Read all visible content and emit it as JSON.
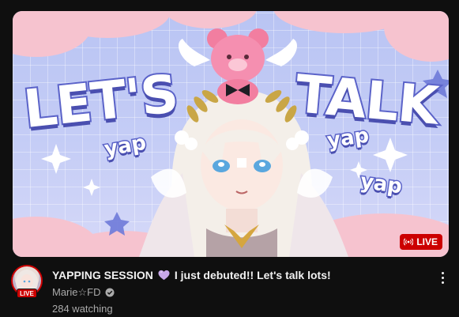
{
  "video": {
    "thumbnail_words": {
      "headline_left": "LET'S",
      "headline_right": "TALK",
      "yap_1": "yap",
      "yap_2": "yap",
      "yap_3": "yap"
    },
    "live_badge": "LIVE",
    "title_part1": "YAPPING SESSION",
    "title_icon": "purple-heart-icon",
    "title_part2": "I just debuted!! Let's talk lots!",
    "channel_name": "Marie☆FD",
    "channel_verified_icon": "verified-check-icon",
    "avatar_live_badge": "LIVE",
    "viewers": "284 watching",
    "menu_icon": "more-vertical-icon"
  },
  "colors": {
    "live_red": "#cc0000",
    "text_primary": "#f1f1f1",
    "text_secondary": "#aaaaaa",
    "background": "#0f0f0f",
    "heart": "#c7a8e8"
  }
}
